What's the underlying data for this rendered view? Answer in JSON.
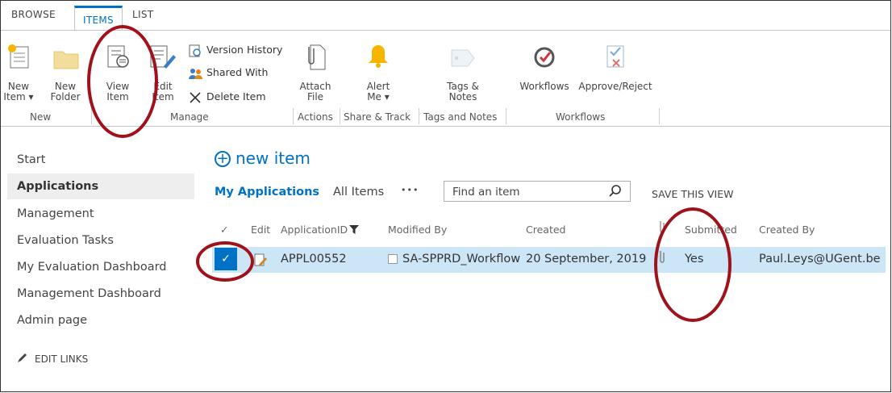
{
  "ribbon": {
    "tabs": [
      "BROWSE",
      "ITEMS",
      "LIST"
    ],
    "buttons": {
      "new_item": [
        "New",
        "Item ▾"
      ],
      "new_folder": [
        "New",
        "Folder"
      ],
      "view_item": [
        "View",
        "Item"
      ],
      "edit_item": [
        "Edit",
        "Item"
      ],
      "attach_file": [
        "Attach",
        "File"
      ],
      "alert_me": [
        "Alert",
        "Me ▾"
      ],
      "tags_notes": [
        "Tags &",
        "Notes"
      ],
      "workflows": "Workflows",
      "approve_reject": "Approve/Reject"
    },
    "small_buttons": [
      "Version History",
      "Shared With",
      "Delete Item"
    ],
    "groups": [
      "New",
      "Manage",
      "Actions",
      "Share & Track",
      "Tags and Notes",
      "Workflows"
    ]
  },
  "nav": {
    "items": [
      "Start",
      "Applications",
      "Management",
      "Evaluation Tasks",
      "My Evaluation Dashboard",
      "Management Dashboard",
      "Admin page"
    ],
    "edit_links": "EDIT LINKS"
  },
  "main": {
    "new_item": "new item",
    "views": [
      "My Applications",
      "All Items",
      "•••"
    ],
    "search_placeholder": "Find an item",
    "save_view": "SAVE THIS VIEW",
    "columns": [
      "Edit",
      "ApplicationID",
      "Modified By",
      "Created",
      "Submitted",
      "Created By"
    ],
    "rows": [
      {
        "application_id": "APPL00552",
        "modified_by": "SA-SPPRD_Workflow",
        "created": "20 September, 2019",
        "submitted": "Yes",
        "created_by": "Paul.Leys@UGent.be"
      }
    ]
  },
  "colors": {
    "accent": "#0072c6",
    "annotation": "#a0121b",
    "selected_row": "#cde6f7"
  }
}
